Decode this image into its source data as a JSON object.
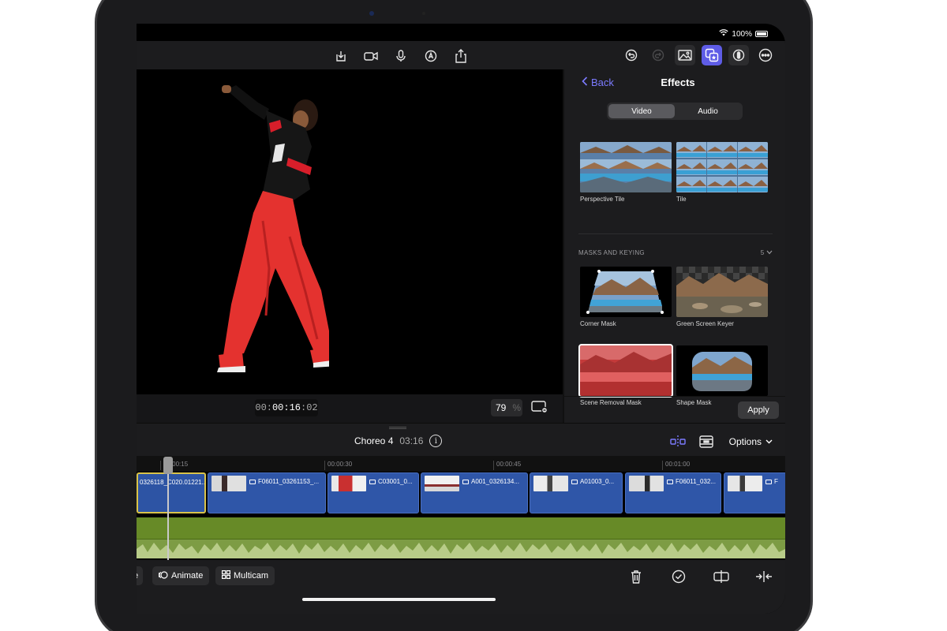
{
  "status": {
    "battery": "100%"
  },
  "toolbar": {
    "center_icons": [
      "import-icon",
      "camera-icon",
      "microphone-icon",
      "pencil-icon",
      "share-icon"
    ],
    "right_icons": [
      "undo-icon",
      "redo-icon",
      "photos-icon",
      "effects-icon",
      "inspector-icon",
      "more-icon"
    ]
  },
  "viewer": {
    "timecode_prefix": "00:",
    "timecode_main": "00:16",
    "timecode_frames": ":02",
    "zoom": "79",
    "zoom_unit": "%"
  },
  "effects": {
    "back_label": "Back",
    "title": "Effects",
    "tabs": [
      "Video",
      "Audio"
    ],
    "selected_tab": "Video",
    "tiles_top": [
      "Perspective Tile",
      "Tile"
    ],
    "section_title": "MASKS AND KEYING",
    "section_count": "5",
    "tiles_masks": [
      "Corner Mask",
      "Green Screen Keyer",
      "Scene Removal Mask",
      "Shape Mask"
    ],
    "apply_label": "Apply"
  },
  "timeline": {
    "project_name": "Choreo 4",
    "project_duration": "03:16",
    "options_label": "Options",
    "ruler": [
      "00:00:15",
      "00:00:30",
      "00:00:45",
      "00:01:00"
    ],
    "clips": [
      "0326118_C020.01221...",
      "F06011_03261153_...",
      "C03001_0...",
      "A001_0326134...",
      "A01003_0...",
      "F06011_032...",
      "F"
    ]
  },
  "bottom": {
    "animate_label": "Animate",
    "multicam_label": "Multicam",
    "partial_label": "e"
  },
  "colors": {
    "accent": "#5e5ce6",
    "clip_blue": "#2f56a8",
    "audio_green": "#6b8e2a",
    "selection_yellow": "#d9c34a"
  }
}
